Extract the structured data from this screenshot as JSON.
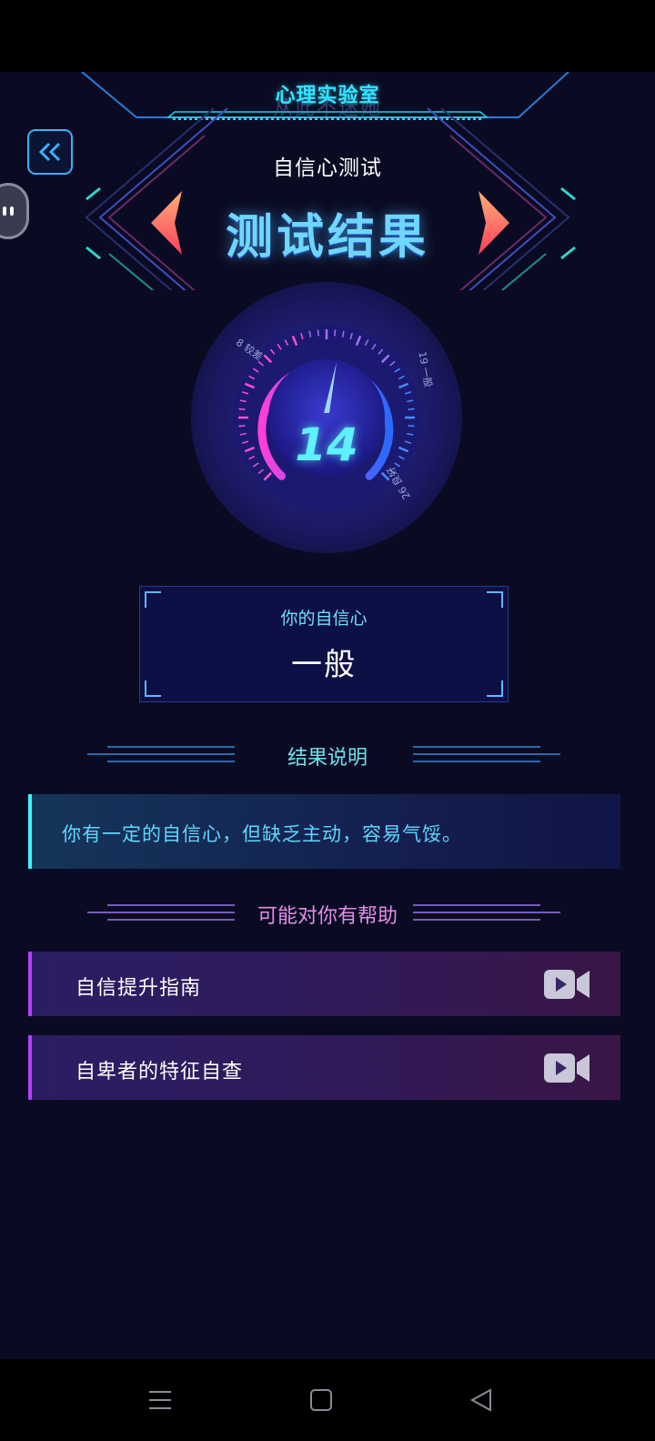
{
  "header": {
    "lab_title": "心理实验室",
    "lab_subtitle": "从此不迷她",
    "test_name": "自信心测试",
    "result_title": "测试结果"
  },
  "gauge": {
    "score": "14",
    "tick_labels": [
      "8 较差",
      "19 一般",
      "26 良好"
    ]
  },
  "level": {
    "label": "你的自信心",
    "value": "一般"
  },
  "explanation": {
    "heading": "结果说明",
    "text": "你有一定的自信心，但缺乏主动，容易气馁。"
  },
  "help": {
    "heading": "可能对你有帮助",
    "items": [
      {
        "label": "自信提升指南",
        "icon": "video-camera-icon"
      },
      {
        "label": "自卑者的特征自查",
        "icon": "video-camera-icon"
      }
    ]
  },
  "colors": {
    "accent_cyan": "#34e3ff",
    "accent_purple": "#b040ff",
    "arrow_coral": "#ff6a5a",
    "background": "#0a0b22"
  }
}
